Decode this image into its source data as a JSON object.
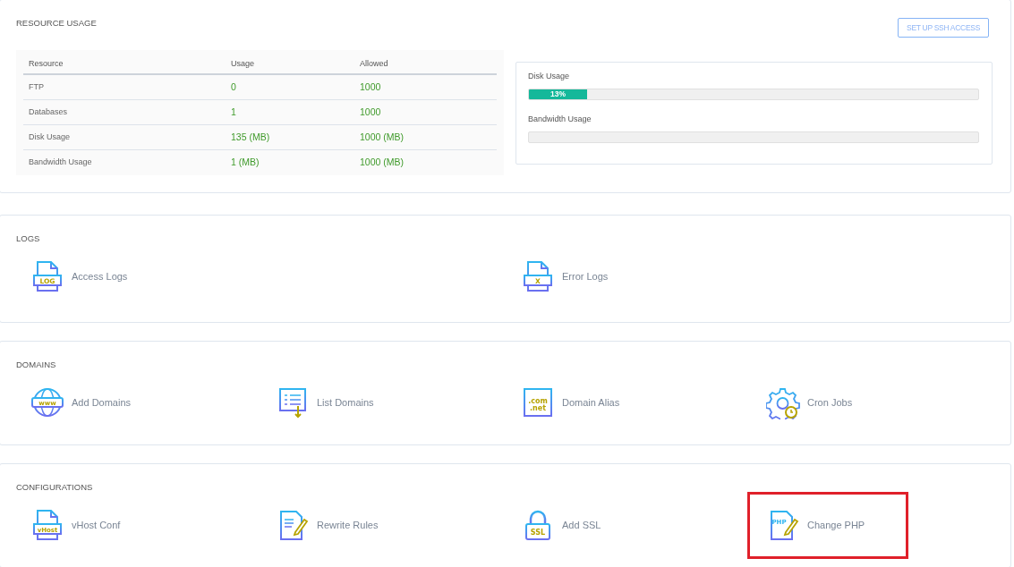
{
  "resource_usage": {
    "title": "RESOURCE USAGE",
    "ssh_button": "SET UP SSH ACCESS",
    "table": {
      "columns": [
        "Resource",
        "Usage",
        "Allowed"
      ],
      "rows": [
        [
          "FTP",
          "0",
          "1000"
        ],
        [
          "Databases",
          "1",
          "1000"
        ],
        [
          "Disk Usage",
          "135 (MB)",
          "1000 (MB)"
        ],
        [
          "Bandwidth Usage",
          "1 (MB)",
          "1000 (MB)"
        ]
      ]
    },
    "meters": [
      {
        "label": "Disk Usage",
        "level": 0.13,
        "reading": "13%"
      },
      {
        "label": "Bandwidth Usage",
        "level": 0
      }
    ]
  },
  "sections": [
    {
      "title": "LOGS",
      "items": [
        {
          "label": "Access Logs",
          "kind": "file",
          "icon_text": "LOG",
          "highlighted": false
        },
        {
          "label": "Error Logs",
          "kind": "file",
          "icon_text": "X",
          "highlighted": false
        }
      ]
    },
    {
      "title": "DOMAINS",
      "items": [
        {
          "label": "Add Domains",
          "kind": "globe",
          "icon_text": "www",
          "highlighted": false
        },
        {
          "label": "List Domains",
          "kind": "list",
          "highlighted": false
        },
        {
          "label": "Domain Alias",
          "kind": "browser",
          "icon_text": ".com .net",
          "highlighted": false
        },
        {
          "label": "Cron Jobs",
          "kind": "gear",
          "highlighted": false
        }
      ]
    },
    {
      "title": "CONFIGURATIONS",
      "items": [
        {
          "label": "vHost Conf",
          "kind": "file",
          "icon_text": "vHost",
          "highlighted": false
        },
        {
          "label": "Rewrite Rules",
          "kind": "edit",
          "highlighted": false
        },
        {
          "label": "Add SSL",
          "kind": "lock",
          "icon_text": "SSL",
          "highlighted": false
        },
        {
          "label": "Change PHP",
          "kind": "edit",
          "icon_text": "PHP",
          "highlighted": true
        }
      ]
    }
  ]
}
